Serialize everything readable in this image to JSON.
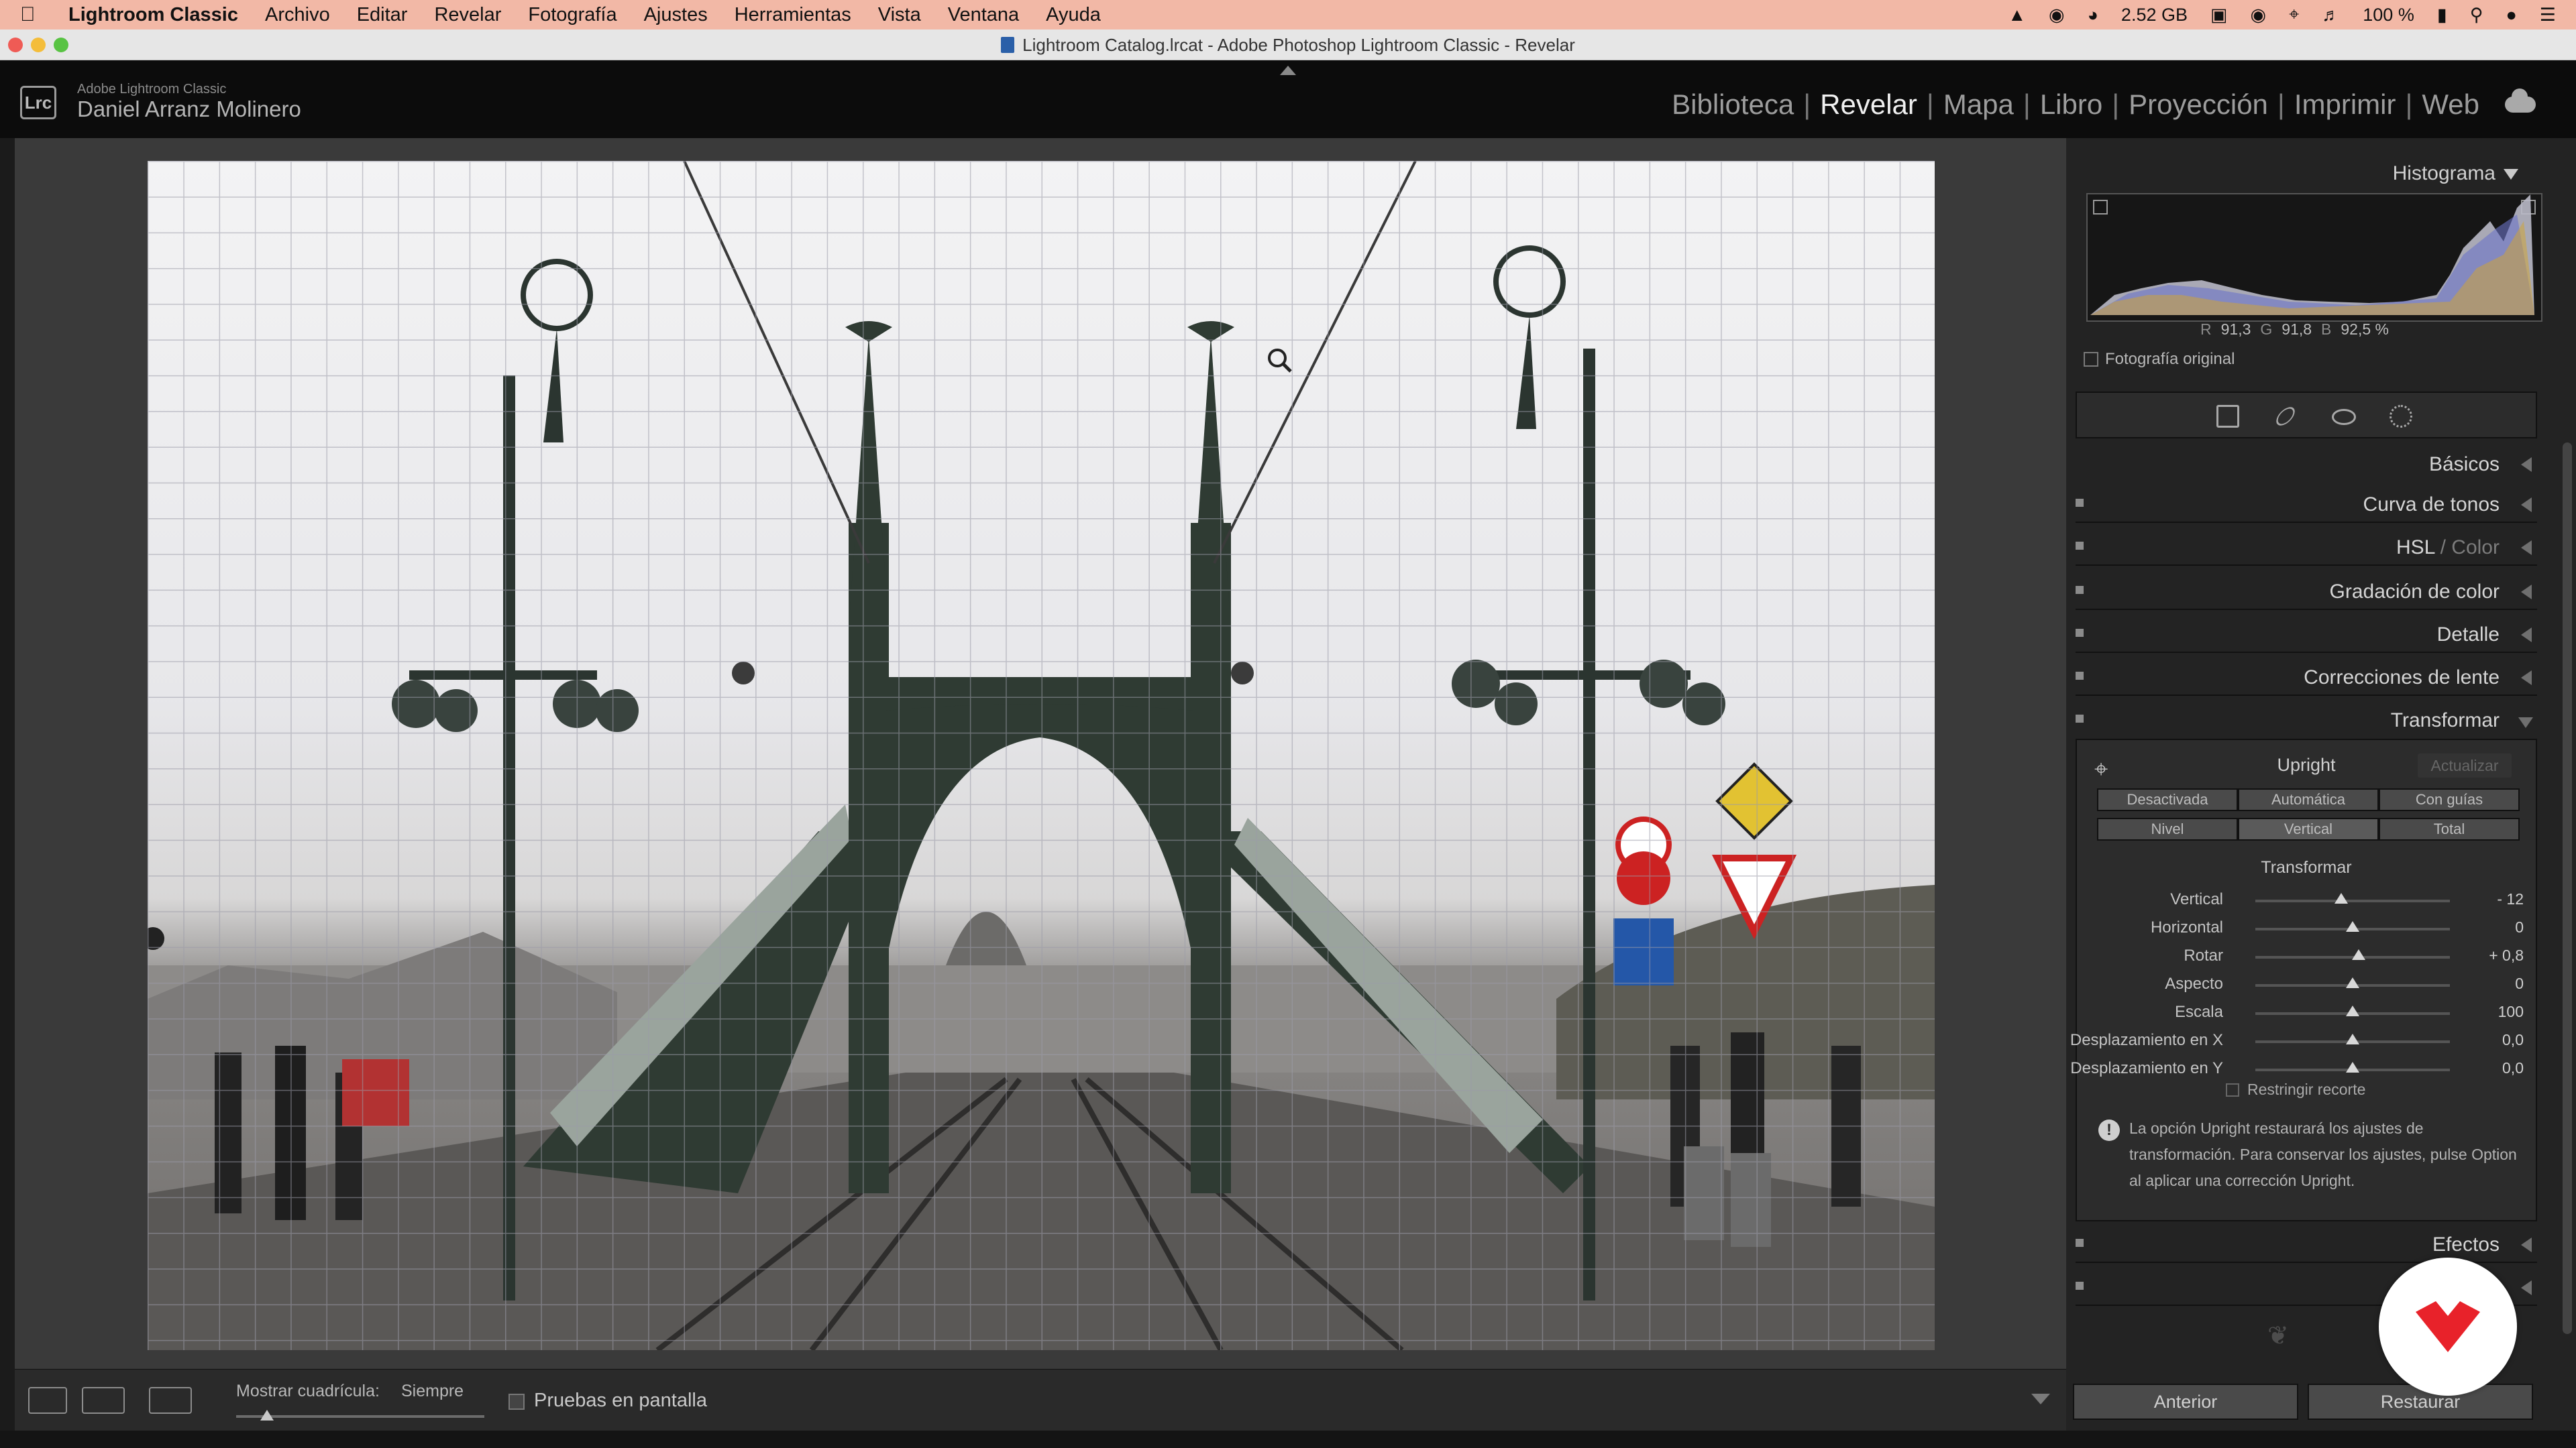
{
  "menubar": {
    "app": "Lightroom Classic",
    "items": [
      "Archivo",
      "Editar",
      "Revelar",
      "Fotografía",
      "Ajustes",
      "Herramientas",
      "Vista",
      "Ventana",
      "Ayuda"
    ],
    "memory": "2.52 GB",
    "battery": "100 %"
  },
  "window": {
    "title": "Lightroom Catalog.lrcat - Adobe Photoshop Lightroom Classic - Revelar"
  },
  "header": {
    "logo": "Lrc",
    "product": "Adobe Lightroom Classic",
    "user": "Daniel Arranz Molinero",
    "modules": [
      "Biblioteca",
      "Revelar",
      "Mapa",
      "Libro",
      "Proyección",
      "Imprimir",
      "Web"
    ],
    "active_module": "Revelar"
  },
  "toolbar": {
    "grid_label": "Mostrar cuadrícula:",
    "grid_value": "Siempre",
    "proof_label": "Pruebas en pantalla"
  },
  "panel": {
    "histogram": {
      "title": "Histograma",
      "r_label": "R",
      "r_value": "91,3",
      "g_label": "G",
      "g_value": "91,8",
      "b_label": "B",
      "b_value": "92,5 %",
      "original_label": "Fotografía original"
    },
    "sections": {
      "basicos": "Básicos",
      "curva": "Curva de tonos",
      "hsl": "HSL",
      "hsl_sep": "/",
      "color": "Color",
      "gradacion": "Gradación de color",
      "detalle": "Detalle",
      "correcciones": "Correcciones de lente",
      "transformar": "Transformar",
      "efectos": "Efectos"
    },
    "upright": {
      "title": "Upright",
      "update": "Actualizar",
      "row1": [
        "Desactivada",
        "Automática",
        "Con guías"
      ],
      "row2": [
        "Nivel",
        "Vertical",
        "Total"
      ]
    },
    "transform": {
      "subtitle": "Transformar",
      "sliders": [
        {
          "label": "Vertical",
          "value": "- 12",
          "pos": 0.44
        },
        {
          "label": "Horizontal",
          "value": "0",
          "pos": 0.5
        },
        {
          "label": "Rotar",
          "value": "+ 0,8",
          "pos": 0.53
        },
        {
          "label": "Aspecto",
          "value": "0",
          "pos": 0.5
        },
        {
          "label": "Escala",
          "value": "100",
          "pos": 0.5
        },
        {
          "label": "Desplazamiento en X",
          "value": "0,0",
          "pos": 0.5
        },
        {
          "label": "Desplazamiento en Y",
          "value": "0,0",
          "pos": 0.5
        }
      ],
      "restrict": "Restringir recorte",
      "info": "La opción Upright restaurará los ajustes de transformación. Para conservar los ajustes, pulse Option al aplicar una corrección Upright."
    },
    "buttons": {
      "prev": "Anterior",
      "reset": "Restaurar"
    }
  },
  "colors": {
    "menubar": "#f2b8a6",
    "panel": "#232323",
    "bridge": "#2f3b33",
    "badge": "#e8222a"
  }
}
